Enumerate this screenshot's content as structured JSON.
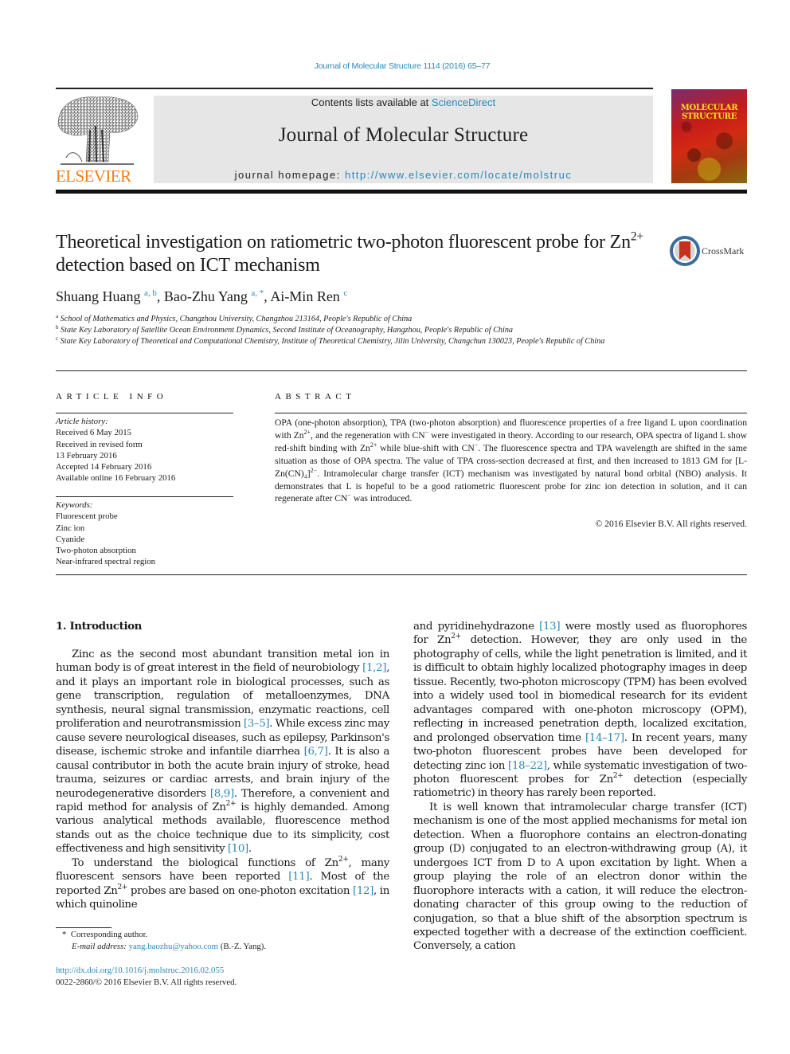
{
  "header": {
    "citation": "Journal of Molecular Structure 1114 (2016) 65–77",
    "contents_prefix": "Contents lists available at ",
    "contents_link": "ScienceDirect",
    "journal_name": "Journal of Molecular Structure",
    "homepage_prefix": "journal homepage: ",
    "homepage_url": "http://www.elsevier.com/locate/molstruc",
    "publisher_logo_text": "ELSEVIER",
    "cover_title_line1": "MOLECULAR",
    "cover_title_line2": "STRUCTURE",
    "colors": {
      "link": "#2a86b7",
      "elsevier_orange": "#f07f16",
      "masthead_bg": "#e6e6e6"
    }
  },
  "article": {
    "title_part1": "Theoretical investigation on ratiometric two-photon fluorescent probe for Zn",
    "title_sup": "2+",
    "title_part2": " detection based on ICT mechanism",
    "crossmark_label": "CrossMark",
    "authors": [
      {
        "name": "Shuang Huang",
        "affil": "a, b"
      },
      {
        "name": "Bao-Zhu Yang",
        "affil": "a, *"
      },
      {
        "name": "Ai-Min Ren",
        "affil": "c"
      }
    ],
    "affiliations": [
      {
        "key": "a",
        "text": "School of Mathematics and Physics, Changzhou University, Changzhou 213164, People's Republic of China"
      },
      {
        "key": "b",
        "text": "State Key Laboratory of Satellite Ocean Environment Dynamics, Second Institute of Oceanography, Hangzhou, People's Republic of China"
      },
      {
        "key": "c",
        "text": "State Key Laboratory of Theoretical and Computational Chemistry, Institute of Theoretical Chemistry, Jilin University, Changchun 130023, People's Republic of China"
      }
    ]
  },
  "article_info": {
    "heading": "ARTICLE INFO",
    "history_label": "Article history:",
    "history": [
      "Received 6 May 2015",
      "Received in revised form",
      "13 February 2016",
      "Accepted 14 February 2016",
      "Available online 16 February 2016"
    ],
    "keywords_label": "Keywords:",
    "keywords": [
      "Fluorescent probe",
      "Zinc ion",
      "Cyanide",
      "Two-photon absorption",
      "Near-infrared spectral region"
    ]
  },
  "abstract": {
    "heading": "ABSTRACT",
    "segments": [
      "OPA (one-photon absorption), TPA (two-photon absorption) and fluorescence properties of a free ligand L upon coordination with Zn",
      "2+",
      ", and the regeneration with CN",
      "−",
      " were investigated in theory. According to our research, OPA spectra of ligand L show red-shift binding with Zn",
      "2+",
      " while blue-shift with CN",
      "−",
      ". The fluorescence spectra and TPA wavelength are shifted in the same situation as those of OPA spectra. The value of TPA cross-section decreased at first, and then increased to 1813 GM for [L-Zn(CN)₄]",
      "2−",
      ". Intramolecular charge transfer (ICT) mechanism was investigated by natural bond orbital (NBO) analysis. It demonstrates that L is hopeful to be a good ratiometric fluorescent probe for zinc ion detection in solution, and it can regenerate after CN",
      "−",
      " was introduced."
    ],
    "copyright": "© 2016 Elsevier B.V. All rights reserved."
  },
  "body": {
    "section_heading": "1.  Introduction",
    "left_paragraphs": [
      [
        {
          "t": "Zinc as the second most abundant transition metal ion in human body is of great interest in the field of neurobiology "
        },
        {
          "ref": "[1,2]"
        },
        {
          "t": ", and it plays an important role in biological processes, such as gene transcription, regulation of metalloenzymes, DNA synthesis, neural signal transmission, enzymatic reactions, cell proliferation and neurotransmission "
        },
        {
          "ref": "[3–5]"
        },
        {
          "t": ". While excess zinc may cause severe neurological diseases, such as epilepsy, Parkinson's disease, ischemic stroke and infantile diarrhea "
        },
        {
          "ref": "[6,7]"
        },
        {
          "t": ". It is also a causal contributor in both the acute brain injury of stroke, head trauma, seizures or cardiac arrests, and brain injury of the neurodegenerative disorders "
        },
        {
          "ref": "[8,9]"
        },
        {
          "t": ". Therefore, a convenient and rapid method for analysis of Zn"
        },
        {
          "sup": "2+"
        },
        {
          "t": " is highly demanded. Among various analytical methods available, fluorescence method stands out as the choice technique due to its simplicity, cost effectiveness and high sensitivity "
        },
        {
          "ref": "[10]"
        },
        {
          "t": "."
        }
      ],
      [
        {
          "t": "To understand the biological functions of Zn"
        },
        {
          "sup": "2+"
        },
        {
          "t": ", many fluorescent sensors have been reported "
        },
        {
          "ref": "[11]"
        },
        {
          "t": ". Most of the reported Zn"
        },
        {
          "sup": "2+"
        },
        {
          "t": " probes are based on one-photon excitation "
        },
        {
          "ref": "[12]"
        },
        {
          "t": ", in which quinoline"
        }
      ]
    ],
    "right_paragraphs": [
      [
        {
          "t": "and pyridinehydrazone "
        },
        {
          "ref": "[13]"
        },
        {
          "t": " were mostly used as fluorophores for Zn"
        },
        {
          "sup": "2+"
        },
        {
          "t": " detection. However, they are only used in the photography of cells, while the light penetration is limited, and it is difficult to obtain highly localized photography images in deep tissue. Recently, two-photon microscopy (TPM) has been evolved into a widely used tool in biomedical research for its evident advantages compared with one-photon microscopy (OPM), reflecting in increased penetration depth, localized excitation, and prolonged observation time "
        },
        {
          "ref": "[14–17]"
        },
        {
          "t": ". In recent years, many two-photon fluorescent probes have been developed for detecting zinc ion "
        },
        {
          "ref": "[18–22]"
        },
        {
          "t": ", while systematic investigation of two-photon fluorescent probes for Zn"
        },
        {
          "sup": "2+"
        },
        {
          "t": " detection (especially ratiometric) in theory has rarely been reported."
        }
      ],
      [
        {
          "t": "It is well known that intramolecular charge transfer (ICT) mechanism is one of the most applied mechanisms for metal ion detection. When a fluorophore contains an electron-donating group (D) conjugated to an electron-withdrawing group (A), it undergoes ICT from D to A upon excitation by light. When a group playing the role of an electron donor within the fluorophore interacts with a cation, it will reduce the electron-donating character of this group owing to the reduction of conjugation, so that a blue shift of the absorption spectrum is expected together with a decrease of the extinction coefficient. Conversely, a cation"
        }
      ]
    ]
  },
  "footnotes": {
    "corresponding_marker": "*",
    "corresponding_text": "Corresponding author.",
    "email_label": "E-mail address:",
    "email": "yang.baozhu@yahoo.com",
    "email_suffix": " (B.-Z. Yang).",
    "doi": "http://dx.doi.org/10.1016/j.molstruc.2016.02.055",
    "issn_line": "0022-2860/© 2016 Elsevier B.V. All rights reserved."
  }
}
